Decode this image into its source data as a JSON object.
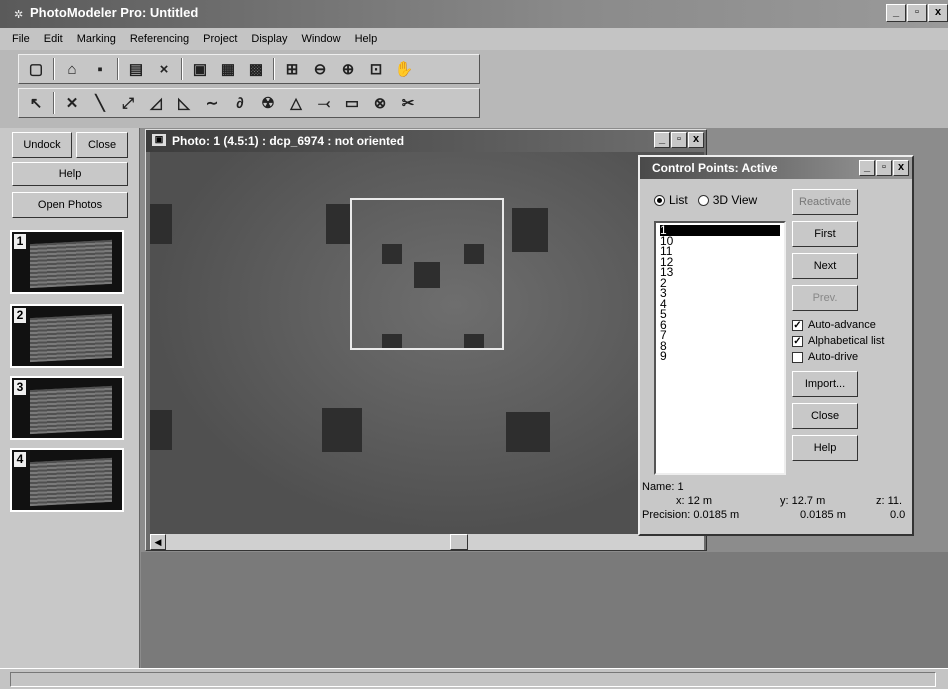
{
  "app": {
    "title": "PhotoModeler Pro: Untitled",
    "window_buttons": [
      "_",
      "▫",
      "x"
    ]
  },
  "menu": [
    "File",
    "Edit",
    "Marking",
    "Referencing",
    "Project",
    "Display",
    "Window",
    "Help"
  ],
  "toolbar1": {
    "icons": [
      "new-file-icon",
      "open-folder-icon",
      "save-icon",
      "photos-table-icon",
      "point-table-icon",
      "photo-view-icon",
      "table-view-icon",
      "3d-view-icon",
      "zoom-window-icon",
      "zoom-out-icon",
      "zoom-in-icon",
      "zoom-fit-icon",
      "pan-icon"
    ]
  },
  "toolbar2": {
    "icons": [
      "pointer-icon",
      "mark-point-icon",
      "line-icon",
      "edge-icon",
      "angle-icon",
      "triangle-icon",
      "curve-icon",
      "cylinder-icon",
      "target-icon",
      "surface-icon",
      "referencing-icon",
      "measure-icon",
      "lock-icon",
      "scale-icon"
    ]
  },
  "leftpane": {
    "undock_label": "Undock",
    "close_label": "Close",
    "help_label": "Help",
    "open_photos_label": "Open Photos",
    "thumbnails": [
      "1",
      "2",
      "3",
      "4"
    ]
  },
  "photo_window": {
    "title": "Photo: 1 (4.5:1) : dcp_6974 : not oriented"
  },
  "control_points": {
    "title": "Control Points: Active",
    "radio_list_label": "List",
    "radio_3d_label": "3D View",
    "selected_view": "List",
    "items": [
      "1",
      "10",
      "11",
      "12",
      "13",
      "2",
      "3",
      "4",
      "5",
      "6",
      "7",
      "8",
      "9"
    ],
    "selected_item": "1",
    "reactivate_label": "Reactivate",
    "first_label": "First",
    "next_label": "Next",
    "prev_label": "Prev.",
    "auto_advance_label": "Auto-advance",
    "auto_advance_checked": true,
    "alphabetical_label": "Alphabetical list",
    "alphabetical_checked": true,
    "auto_drive_label": "Auto-drive",
    "auto_drive_checked": false,
    "import_label": "Import...",
    "close_label": "Close",
    "help_label": "Help",
    "name_text": "Name: 1",
    "x_text": "x: 12 m",
    "y_text": "y: 12.7 m",
    "z_text": "z: 11.",
    "precision_text": "Precision: 0.0185 m",
    "precision_y_text": "0.0185 m",
    "precision_z_text": "0.0"
  }
}
